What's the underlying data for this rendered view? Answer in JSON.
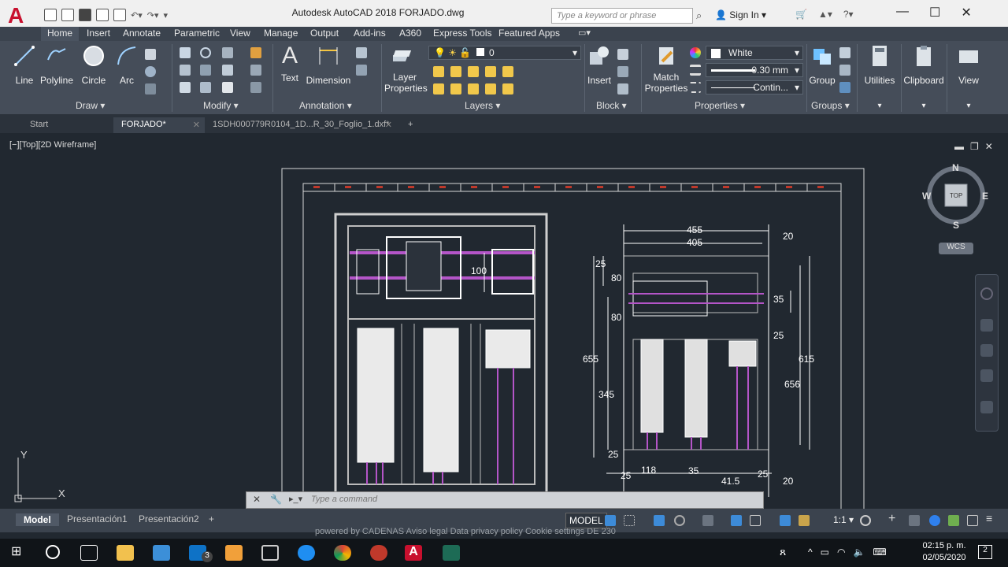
{
  "window": {
    "title": "Autodesk AutoCAD 2018     FORJADO.dwg",
    "search_placeholder": "Type a keyword or phrase",
    "sign_in": "Sign In"
  },
  "ribbon_tabs": [
    "Home",
    "Insert",
    "Annotate",
    "Parametric",
    "View",
    "Manage",
    "Output",
    "Add-ins",
    "A360",
    "Express Tools",
    "Featured Apps"
  ],
  "ribbon": {
    "draw": {
      "label": "Draw",
      "buttons": [
        "Line",
        "Polyline",
        "Circle",
        "Arc"
      ]
    },
    "modify": {
      "label": "Modify"
    },
    "annotation": {
      "label": "Annotation",
      "buttons": [
        "Text",
        "Dimension"
      ]
    },
    "layers": {
      "label": "Layers",
      "button": "Layer\nProperties",
      "current_layer": "0"
    },
    "block": {
      "label": "Block",
      "button": "Insert"
    },
    "properties": {
      "label": "Properties",
      "button": "Match\nProperties",
      "color": "White",
      "lineweight": "0.30 mm",
      "linetype": "Contin..."
    },
    "groups": {
      "label": "Groups",
      "button": "Group"
    },
    "utilities": {
      "button": "Utilities"
    },
    "clipboard": {
      "button": "Clipboard"
    },
    "view": {
      "button": "View"
    }
  },
  "file_tabs": [
    {
      "label": "Start"
    },
    {
      "label": "FORJADO*"
    },
    {
      "label": "1SDH000779R0104_1D...R_30_Foglio_1.dxf*"
    }
  ],
  "viewport_label": "[−][Top][2D Wireframe]",
  "viewcube": {
    "top": "TOP",
    "n": "N",
    "s": "S",
    "e": "E",
    "w": "W",
    "wcs": "WCS"
  },
  "drawing": {
    "dims": [
      "455",
      "405",
      "20",
      "25",
      "80",
      "100",
      "35",
      "80",
      "25",
      "655",
      "615",
      "656",
      "345",
      "25",
      "118",
      "35",
      "41.5",
      "25",
      "20",
      "25"
    ],
    "ucs_x": "X",
    "ucs_y": "Y"
  },
  "command_placeholder": "Type a command",
  "layout_tabs": [
    "Model",
    "Presentación1",
    "Presentación2"
  ],
  "status": {
    "model": "MODEL",
    "scale": "1:1"
  },
  "background_text": "powered by CADENAS   Aviso legal   Data privacy policy   Cookie settings   DE 230",
  "clock": {
    "time": "02:15 p. m.",
    "date": "02/05/2020"
  },
  "notification_count": "2",
  "mail_badge": "3"
}
